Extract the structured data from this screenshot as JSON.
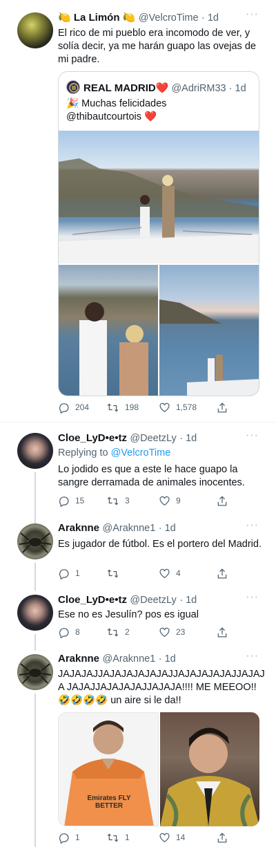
{
  "tweet1": {
    "name": "🍋 La Limón 🍋",
    "handle": "@VelcroTime",
    "time": "· 1d",
    "text": "El rico de mi pueblo era incomodo de ver, y solía decir, ya me harán guapo las ovejas de mi padre.",
    "quote": {
      "name": "REAL MADRID❤️",
      "handle": "@AdriRM33",
      "time": "· 1d",
      "text": "🎉 Muchas felicidades\n@thibautcourtois ❤️"
    },
    "actions": {
      "replies": "204",
      "retweets": "198",
      "likes": "1,578"
    }
  },
  "tweet2": {
    "name": "Cloe_LyD•e•tz",
    "handle": "@DeetzLy",
    "time": "· 1d",
    "replying_prefix": "Replying to",
    "replying_to": "@VelcroTime",
    "text": "Lo jodido es que a este le hace guapo la sangre derramada de animales inocentes.",
    "actions": {
      "replies": "15",
      "retweets": "3",
      "likes": "9"
    }
  },
  "tweet3": {
    "name": "Araknne",
    "handle": "@Araknne1",
    "time": "· 1d",
    "text": "Es jugador de fútbol. Es el portero del Madrid.",
    "actions": {
      "replies": "1",
      "retweets": "",
      "likes": "4"
    }
  },
  "tweet4": {
    "name": "Cloe_LyD•e•tz",
    "handle": "@DeetzLy",
    "time": "· 1d",
    "text": "Ese no es Jesulín? pos es igual",
    "actions": {
      "replies": "8",
      "retweets": "2",
      "likes": "23"
    }
  },
  "tweet5": {
    "name": "Araknne",
    "handle": "@Araknne1",
    "time": "· 1d",
    "text": "JAJAJAJJAJAJAJAJAJAJJAJAJAJAJAJJAJAJA JAJAJJAJAJAJAJJAJAJA!!!! ME MEEOO!!\n🤣🤣🤣🤣 un aire si le da!!",
    "image_caption": "Emirates FLY BETTER",
    "actions": {
      "replies": "1",
      "retweets": "1",
      "likes": "14"
    }
  },
  "more": "···"
}
